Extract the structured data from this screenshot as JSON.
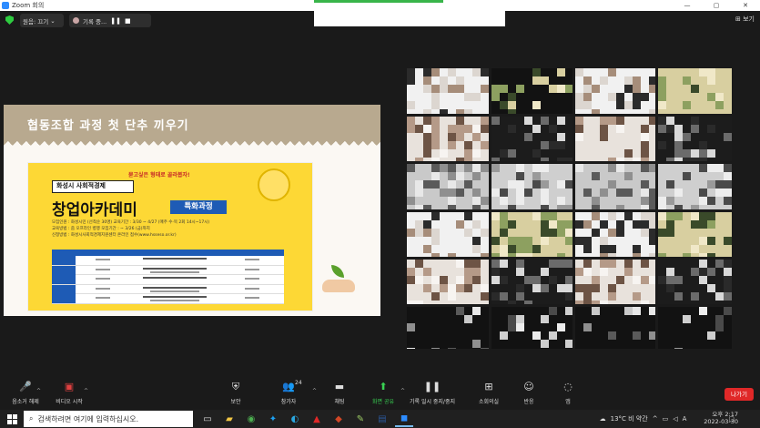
{
  "window": {
    "title": "Zoom 회의",
    "min": "—",
    "max": "▢",
    "close": "✕"
  },
  "top": {
    "view_label": "원음: 끄기",
    "record_label": "기록 중...",
    "pause_icon": "❚❚",
    "stop_icon": "■",
    "view_button": "⊞ 보기"
  },
  "slide": {
    "title": "협동조합 과정 첫 단추 끼우기",
    "poster": {
      "tagline": "묻고싶은 형태로 골라봅자!",
      "line1": "화성시 사회적경제",
      "line2": "창업아카데미",
      "badge": "특화과정",
      "info": [
        "모집인원 : 화성시민 (선착순 30명)     교육기간 : 3/30 ~ 4/27 (매주 수·목 2회 14시~17시)",
        "교육방법 : 줌 오프라인 병행           모집기간 : ~ 3/26 (금)까지",
        "신청방법 : 화성시사회적경제지원센터 온라인 접수(www.hsseso.or.kr)"
      ]
    }
  },
  "controls": [
    {
      "name": "mute",
      "icon": "🎤",
      "label": "음소거 해제"
    },
    {
      "name": "video",
      "icon": "▣",
      "label": "비디오 시작"
    },
    {
      "name": "security",
      "icon": "⛨",
      "label": "보안"
    },
    {
      "name": "participants",
      "icon": "👥",
      "label": "참가자",
      "count": "24"
    },
    {
      "name": "chat",
      "icon": "▬",
      "label": "채팅"
    },
    {
      "name": "share",
      "icon": "⬆",
      "label": "화면 공유"
    },
    {
      "name": "record",
      "icon": "❚❚",
      "label": "기록 일시 중지/중지"
    },
    {
      "name": "rooms",
      "icon": "⊞",
      "label": "소회의실"
    },
    {
      "name": "reactions",
      "icon": "☺",
      "label": "반응"
    },
    {
      "name": "apps",
      "icon": "◌",
      "label": "앱"
    }
  ],
  "leave_label": "나가기",
  "taskbar": {
    "search_placeholder": "검색하려면 여기에 입력하십시오.",
    "weather": "13°C  비 약간",
    "ime": "A",
    "time": "오후 2:17",
    "date": "2022-03-30"
  },
  "colors": {
    "zoom_blue": "#2d8cff",
    "leave_red": "#e02828",
    "poster_yellow": "#fdd835",
    "poster_blue": "#1e5bb5"
  }
}
